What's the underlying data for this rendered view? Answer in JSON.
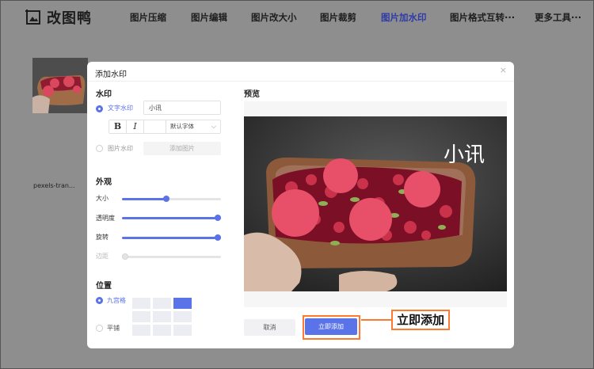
{
  "app": {
    "name": "改图鸭"
  },
  "nav": {
    "items": [
      {
        "label": "图片压缩"
      },
      {
        "label": "图片编辑"
      },
      {
        "label": "图片改大小"
      },
      {
        "label": "图片裁剪"
      },
      {
        "label": "图片加水印",
        "active": true
      },
      {
        "label": "图片格式互转···"
      },
      {
        "label": "更多工具···"
      }
    ]
  },
  "file": {
    "name": "pexels-tran...",
    "close_icon": "close-circle-icon"
  },
  "modal": {
    "title": "添加水印",
    "close": "×",
    "watermark": {
      "section": "水印",
      "text_option": "文字水印",
      "text_value": "小讯",
      "bold": "B",
      "italic": "I",
      "font": "默认字体",
      "image_option": "图片水印",
      "add_image": "添加图片",
      "selected": "text"
    },
    "appearance": {
      "section": "外观",
      "sliders": [
        {
          "label": "大小",
          "value": 0.45,
          "enabled": true
        },
        {
          "label": "透明度",
          "value": 1.0,
          "enabled": true
        },
        {
          "label": "旋转",
          "value": 1.0,
          "enabled": true
        },
        {
          "label": "边距",
          "value": 0.0,
          "enabled": false
        }
      ]
    },
    "position": {
      "section": "位置",
      "grid_option": "九宫格",
      "tile_option": "平铺",
      "selected_cell": 2
    },
    "preview": {
      "label": "预览",
      "watermark_text": "小讯"
    },
    "buttons": {
      "cancel": "取消",
      "apply": "立即添加"
    }
  },
  "annotation": {
    "callout": "立即添加"
  },
  "colors": {
    "accent": "#5a73e8",
    "highlight": "#ff7a30",
    "overlay": "#8e8e8e"
  }
}
